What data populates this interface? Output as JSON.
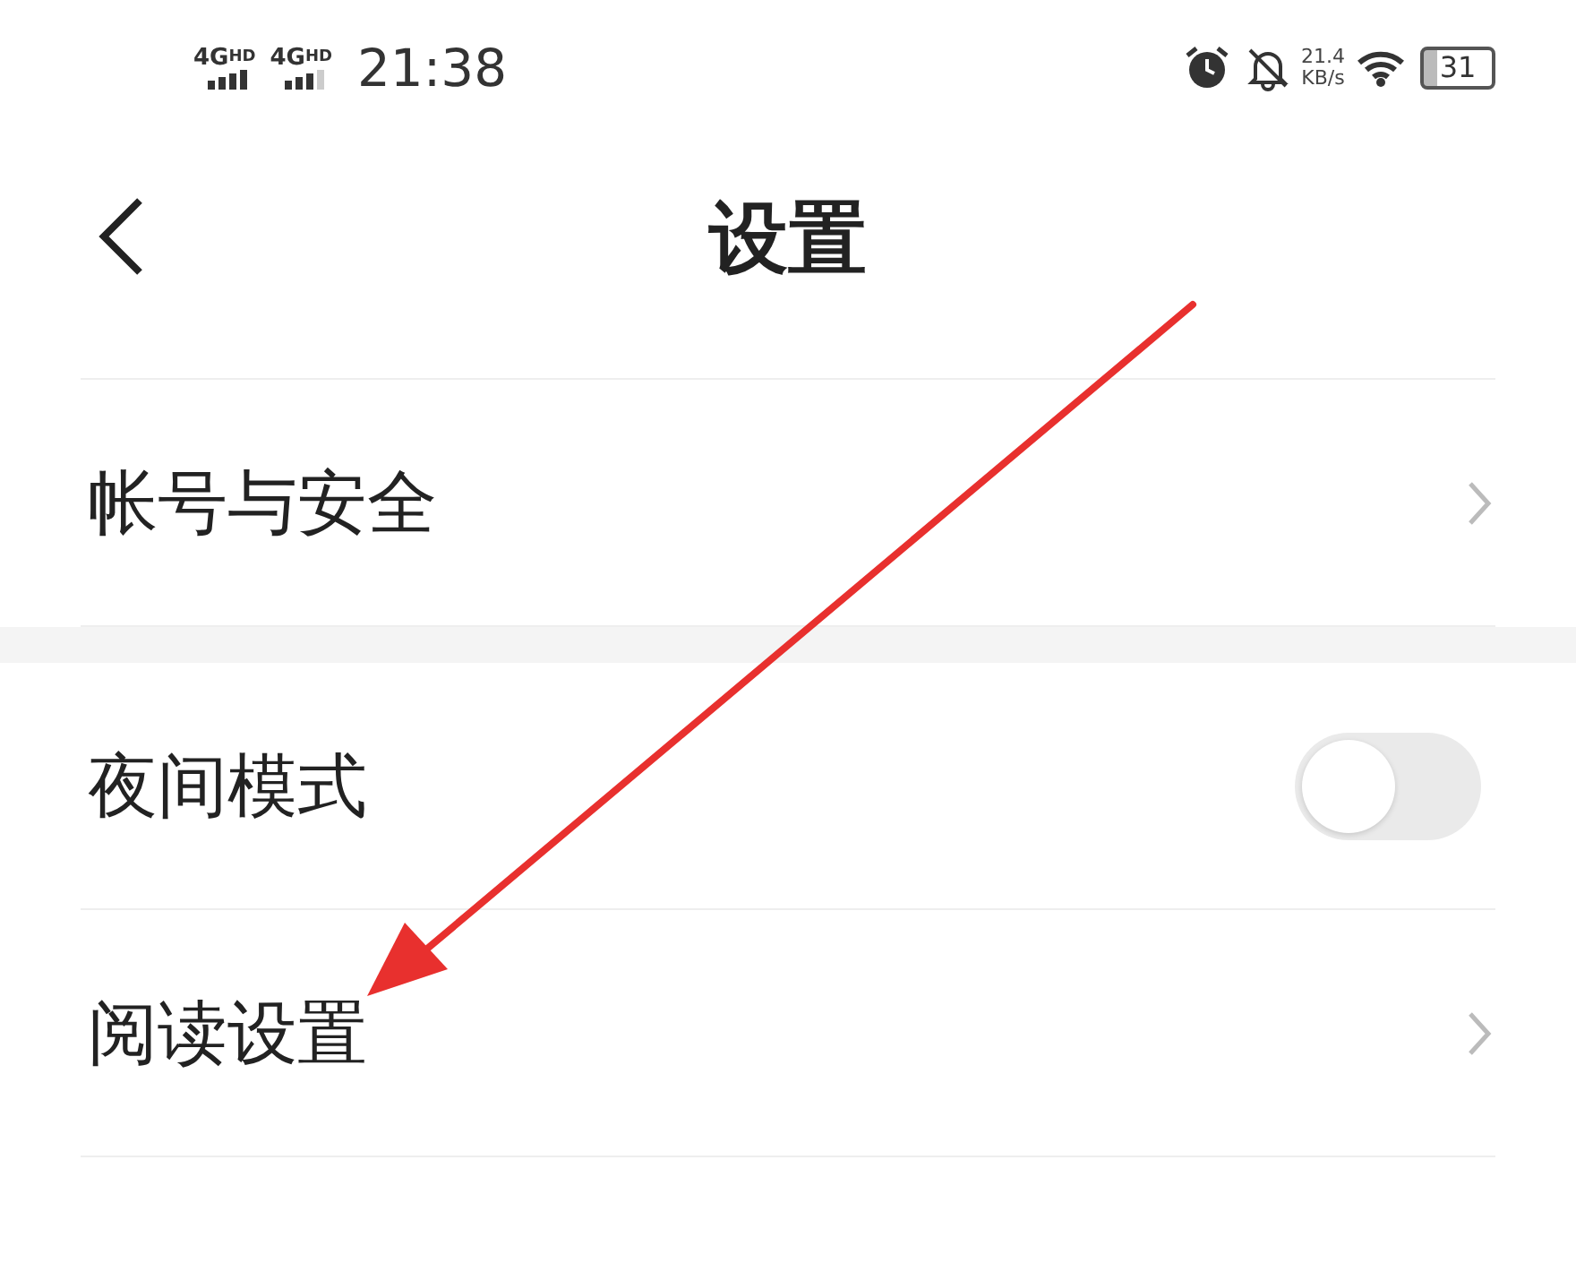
{
  "status_bar": {
    "signals": [
      "4G$^{HD}$",
      "4G$^{HD}$"
    ],
    "time": "21:38",
    "net_speed": "21.4",
    "net_speed_unit": "KB/s",
    "battery": "31"
  },
  "header": {
    "title": "设置"
  },
  "sections": [
    {
      "rows": [
        {
          "kind": "link",
          "label": "帐号与安全"
        }
      ]
    },
    {
      "rows": [
        {
          "kind": "toggle",
          "label": "夜间模式",
          "on": false
        },
        {
          "kind": "link",
          "label": "阅读设置"
        }
      ]
    }
  ],
  "annotation": {
    "kind": "arrow"
  }
}
